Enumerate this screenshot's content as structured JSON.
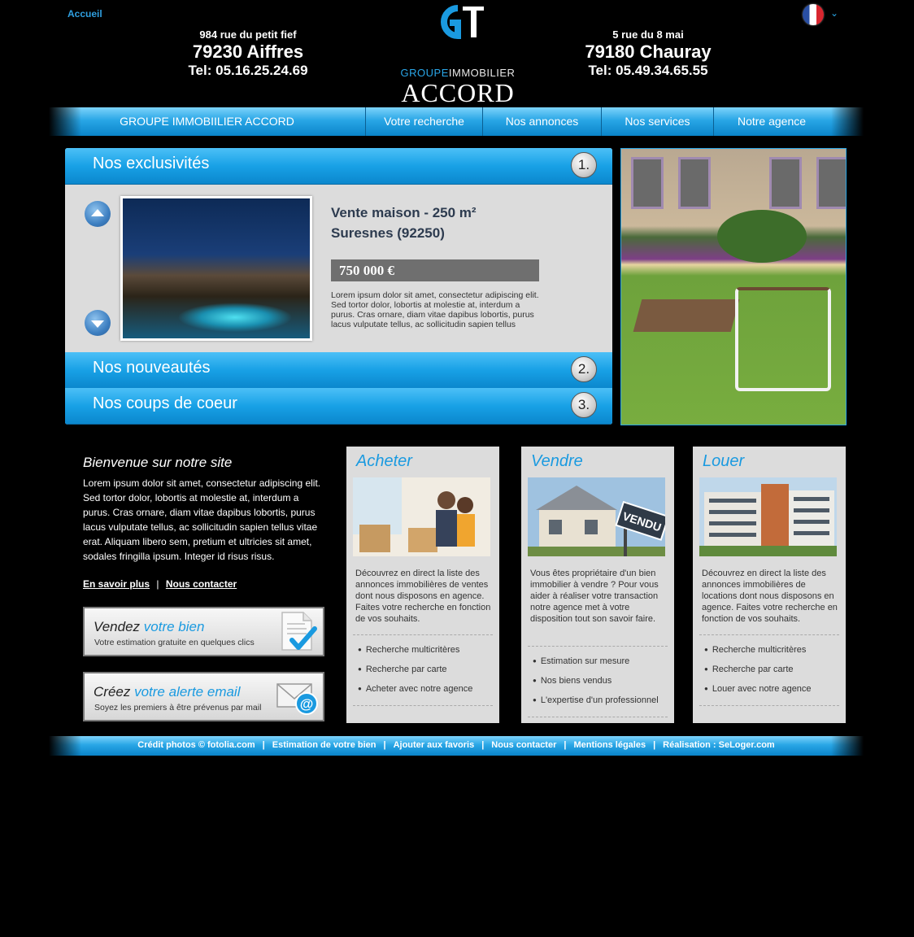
{
  "header": {
    "home_link": "Accueil",
    "agency_left": {
      "street": "984 rue du petit fief",
      "city": "79230 Aiffres",
      "tel": "Tel: 05.16.25.24.69"
    },
    "agency_right": {
      "street": "5 rue du 8 mai",
      "city": "79180 Chauray",
      "tel": "Tel: 05.49.34.65.55"
    },
    "logo": {
      "mark": "GI",
      "line1_a": "GROUPE",
      "line1_b": "IMMOBILIER",
      "line2": "ACCORD"
    },
    "language_icon": "france-flag-icon"
  },
  "nav": {
    "items": [
      {
        "label": "GROUPE IMMOBIILIER ACCORD"
      },
      {
        "label": "Votre recherche"
      },
      {
        "label": "Nos annonces"
      },
      {
        "label": "Nos services"
      },
      {
        "label": "Notre agence"
      }
    ]
  },
  "accordion": {
    "sections": [
      {
        "title": "Nos exclusivités",
        "number": "1."
      },
      {
        "title": "Nos nouveautés",
        "number": "2."
      },
      {
        "title": "Nos coups de coeur",
        "number": "3."
      }
    ],
    "listing": {
      "title_line1": "Vente maison - 250 m²",
      "title_line2": "Suresnes (92250)",
      "price": "750 000 €",
      "description": "Lorem ipsum dolor sit amet, consectetur adipiscing elit. Sed tortor dolor, lobortis at molestie at, interdum a purus. Cras ornare, diam vitae dapibus lobortis, purus lacus vulputate tellus, ac sollicitudin sapien tellus"
    }
  },
  "welcome": {
    "title": "Bienvenue sur notre site",
    "text": "Lorem ipsum dolor sit amet, consectetur adipiscing elit. Sed tortor dolor, lobortis at molestie at, interdum a purus. Cras ornare, diam vitae dapibus lobortis, purus lacus vulputate tellus, ac sollicitudin sapien tellus vitae erat. Aliquam libero sem, pretium et ultricies sit amet, sodales fringilla ipsum. Integer id risus risus.",
    "link_more": "En savoir plus",
    "link_sep": "|",
    "link_contact": "Nous contacter"
  },
  "promos": [
    {
      "title_a": "Vendez",
      "title_b": "votre bien",
      "subtitle": "Votre estimation gratuite en quelques clics",
      "icon": "document-check-icon"
    },
    {
      "title_a": "Créez",
      "title_b": "votre alerte email",
      "subtitle": "Soyez les premiers à être prévenus par mail",
      "icon": "email-envelope-icon"
    }
  ],
  "services": [
    {
      "title": "Acheter",
      "description": "Découvrez en direct la liste des annonces immobilières de ventes dont nous disposons en agence. Faites votre recherche en fonction de vos souhaits.",
      "items": [
        "Recherche multicritères",
        "Recherche par carte",
        "Acheter avec notre agence"
      ]
    },
    {
      "title": "Vendre",
      "description": "Vous êtes propriétaire d'un bien immobilier à vendre ? Pour vous aider à réaliser votre transaction notre agence met à votre disposition tout son savoir faire.",
      "items": [
        "Estimation sur mesure",
        "Nos biens vendus",
        "L'expertise d'un professionnel"
      ],
      "sign_text": "VENDU"
    },
    {
      "title": "Louer",
      "description": "Découvrez en direct la liste des annonces immobilières de locations dont nous disposons en agence. Faites votre recherche en fonction de vos souhaits.",
      "items": [
        "Recherche multicritères",
        "Recherche par carte",
        "Louer avec notre agence"
      ]
    }
  ],
  "footer": {
    "links": [
      "Crédit photos © fotolia.com",
      "Estimation de votre bien",
      "Ajouter aux favoris",
      "Nous contacter",
      "Mentions légales",
      "Réalisation : SeLoger.com"
    ],
    "sep": "|"
  },
  "colors": {
    "accent": "#1a9ae0",
    "nav_top": "#7dd3fb",
    "nav_bottom": "#0a84c9",
    "panel": "#dcdcdc",
    "price_bg": "#6f6f6f"
  }
}
